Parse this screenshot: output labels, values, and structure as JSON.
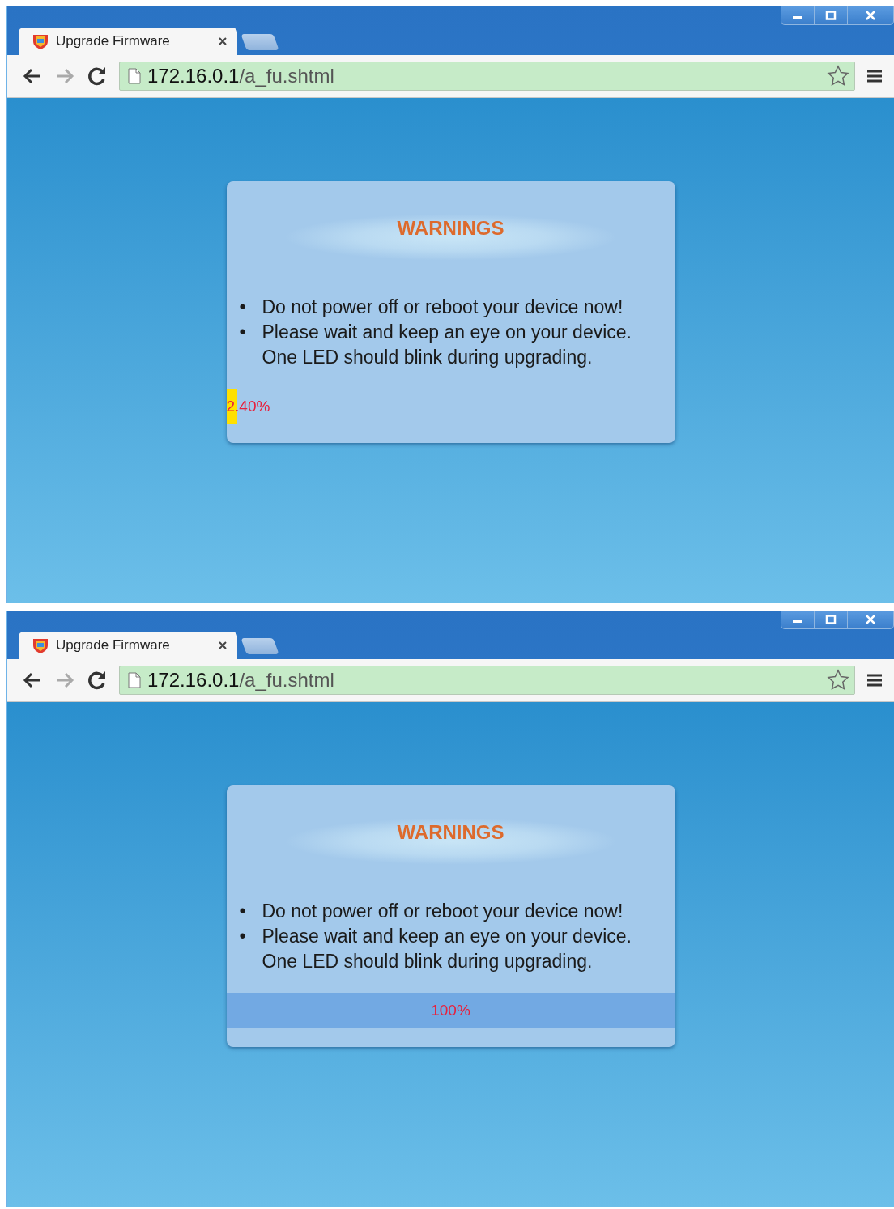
{
  "windows": [
    {
      "tab": {
        "title": "Upgrade Firmware"
      },
      "address": {
        "host": "172.16.0.1",
        "path": "/a_fu.shtml"
      },
      "dialog": {
        "title": "WARNINGS",
        "bullets": [
          {
            "marker": "•",
            "text": "Do not power off or reboot your device now!"
          },
          {
            "marker": "•",
            "text": "Please wait and keep an eye on your device. One LED should blink during upgrading."
          }
        ],
        "progress": {
          "level": 0.024,
          "reading": "2.40%",
          "color": "#ffe000"
        }
      }
    },
    {
      "tab": {
        "title": "Upgrade Firmware"
      },
      "address": {
        "host": "172.16.0.1",
        "path": "/a_fu.shtml"
      },
      "dialog": {
        "title": "WARNINGS",
        "bullets": [
          {
            "marker": "•",
            "text": "Do not power off or reboot your device now!"
          },
          {
            "marker": "•",
            "text": "Please wait and keep an eye on your device. One LED should blink during upgrading."
          }
        ],
        "progress": {
          "level": 1,
          "reading": "100%",
          "color": "#72a9e3"
        }
      }
    }
  ]
}
